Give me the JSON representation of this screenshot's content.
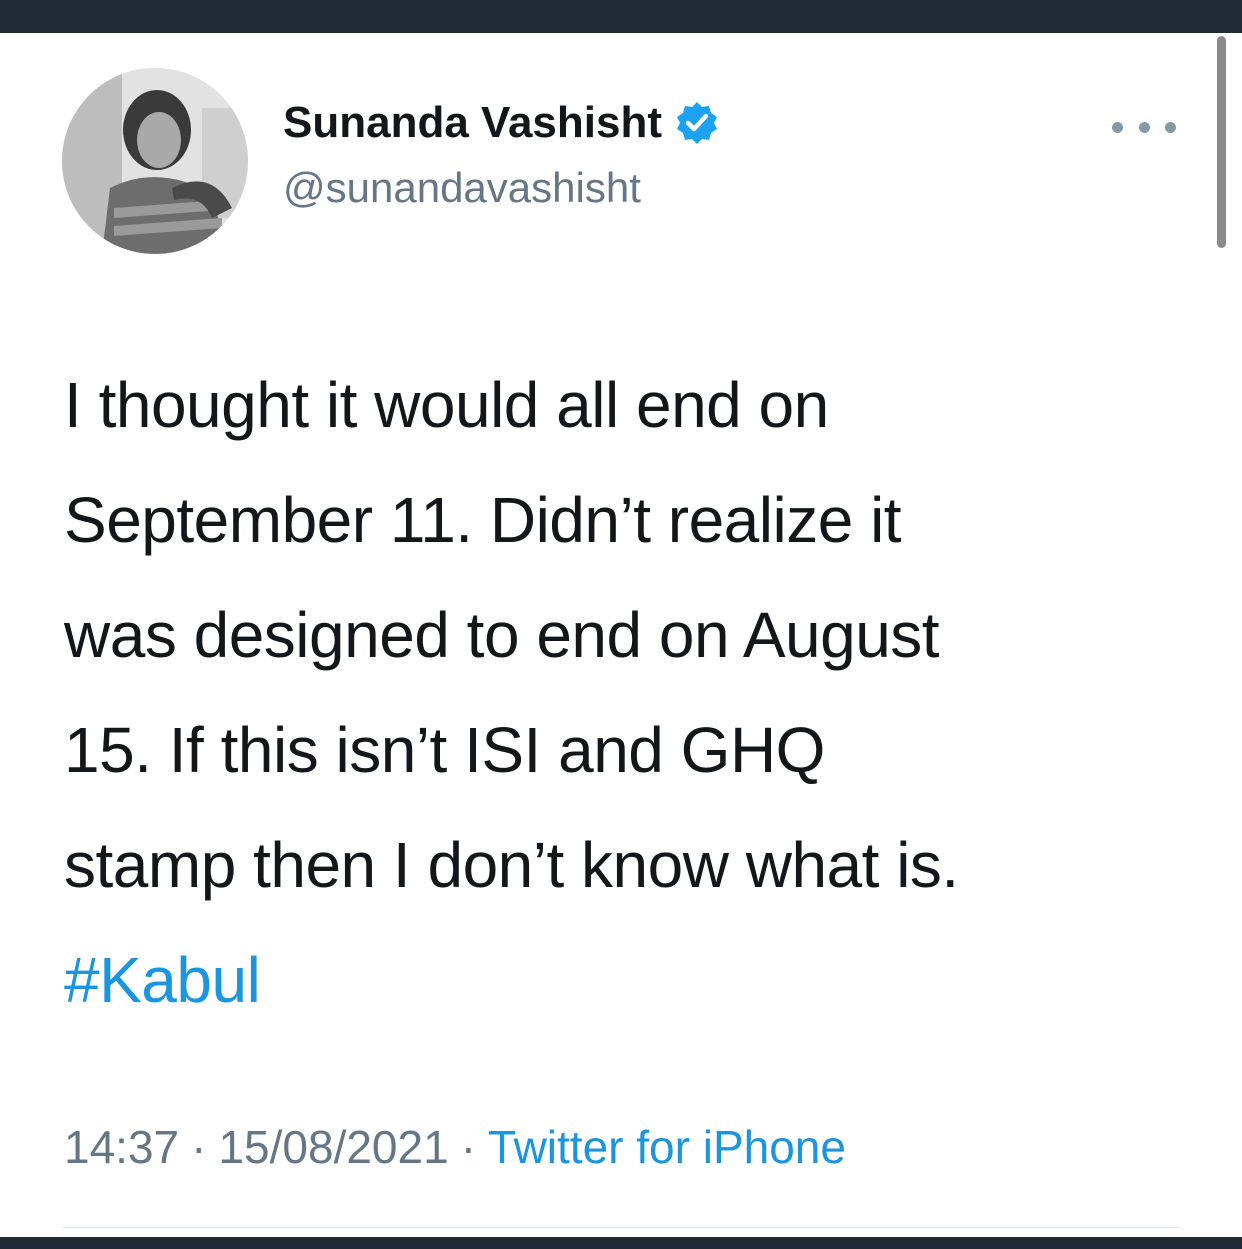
{
  "tweet": {
    "author": {
      "display_name": "Sunanda Vashisht",
      "handle": "@sunandavashisht",
      "verified": true,
      "avatar": "profile-photo"
    },
    "text_lines": [
      "I thought it would all end on",
      "September 11. Didn’t realize it",
      "was designed to end on August",
      "15. If this isn’t ISI and GHQ",
      "stamp then I don’t know what is."
    ],
    "hashtag": "#Kabul",
    "time": "14:37",
    "date": "15/08/2021",
    "separator": "·",
    "source": "Twitter for iPhone",
    "more_icon": "more-horizontal-icon",
    "verified_icon": "verified-badge-icon"
  },
  "colors": {
    "text": "#14171a",
    "muted": "#657786",
    "link": "#1b95e0",
    "verified": "#1da1f2",
    "frame": "#1f2a34"
  }
}
